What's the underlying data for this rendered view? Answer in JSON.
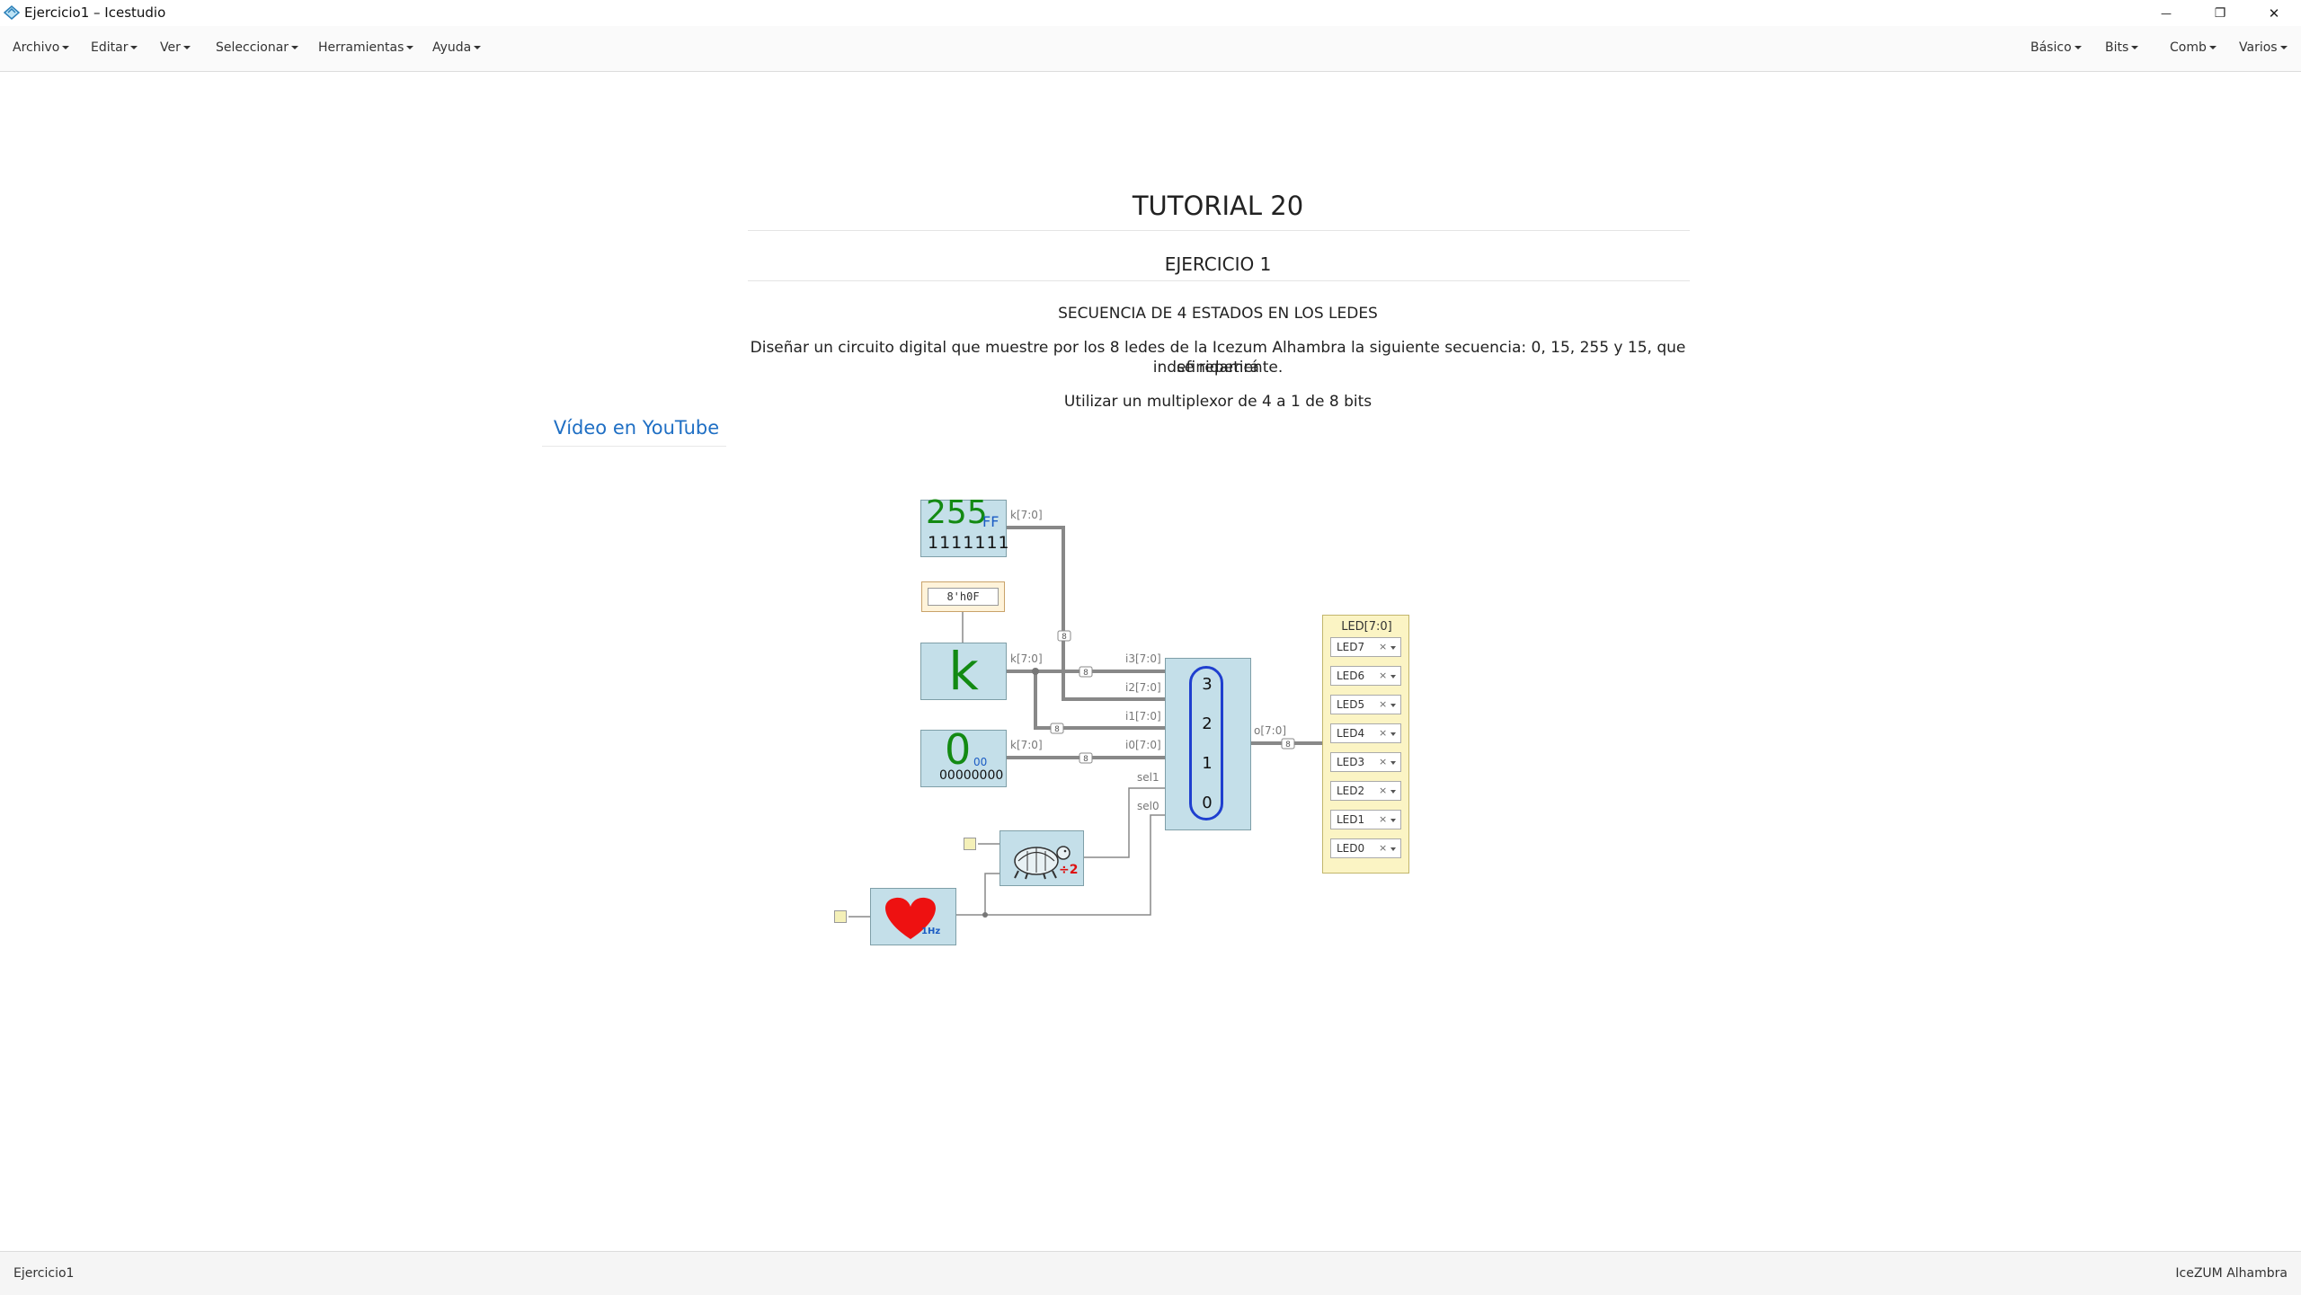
{
  "window": {
    "title": "Ejercicio1 – Icestudio",
    "minimize_glyph": "—",
    "restore_glyph": "❐",
    "close_glyph": "✕"
  },
  "menu": {
    "left": [
      "Archivo",
      "Editar",
      "Ver",
      "Seleccionar",
      "Herramientas",
      "Ayuda"
    ],
    "right": [
      "Básico",
      "Bits",
      "Comb",
      "Varios"
    ]
  },
  "info": {
    "title": "TUTORIAL 20",
    "subtitle": "EJERCICIO 1",
    "heading": "SECUENCIA DE 4 ESTADOS EN LOS LEDES",
    "description_line1": "Diseñar un circuito digital que muestre por los 8 ledes de la Icezum Alhambra la siguiente secuencia: 0, 15, 255 y 15, que se repetirá",
    "description_line2": "indefinidamente.",
    "note": "Utilizar un multiplexor de 4 a 1 de 8 bits",
    "link": "Vídeo en YouTube"
  },
  "circuit": {
    "const255": {
      "dec": "255",
      "hex": "FF",
      "bin": "1111111"
    },
    "param_value": "8'h0F",
    "const_k": {
      "label": "k"
    },
    "const0": {
      "dec": "0",
      "hex": "00",
      "bin": "00000000"
    },
    "out_port_label": "k[7:0]",
    "mux_inputs": [
      "i3[7:0]",
      "i2[7:0]",
      "i1[7:0]",
      "i0[7:0]"
    ],
    "mux_selects": [
      "sel1",
      "sel0"
    ],
    "mux_numbers": [
      "3",
      "2",
      "1",
      "0"
    ],
    "mux_output": "o[7:0]",
    "bus_width": "8",
    "prescaler_label": "÷2",
    "clock_label": "1Hz",
    "led_panel": {
      "title": "LED[7:0]",
      "items": [
        "LED7",
        "LED6",
        "LED5",
        "LED4",
        "LED3",
        "LED2",
        "LED1",
        "LED0"
      ],
      "remove_glyph": "×"
    }
  },
  "status": {
    "left": "Ejercicio1",
    "right": "IceZUM Alhambra"
  },
  "colors": {
    "block_fill": "#c4dfe9",
    "const_text": "#138a13",
    "hex_text": "#1b5cc4",
    "mux_outline": "#1f3fcf",
    "wire": "#888888",
    "led_panel": "#fbf4c4",
    "heart": "#ee1111"
  }
}
